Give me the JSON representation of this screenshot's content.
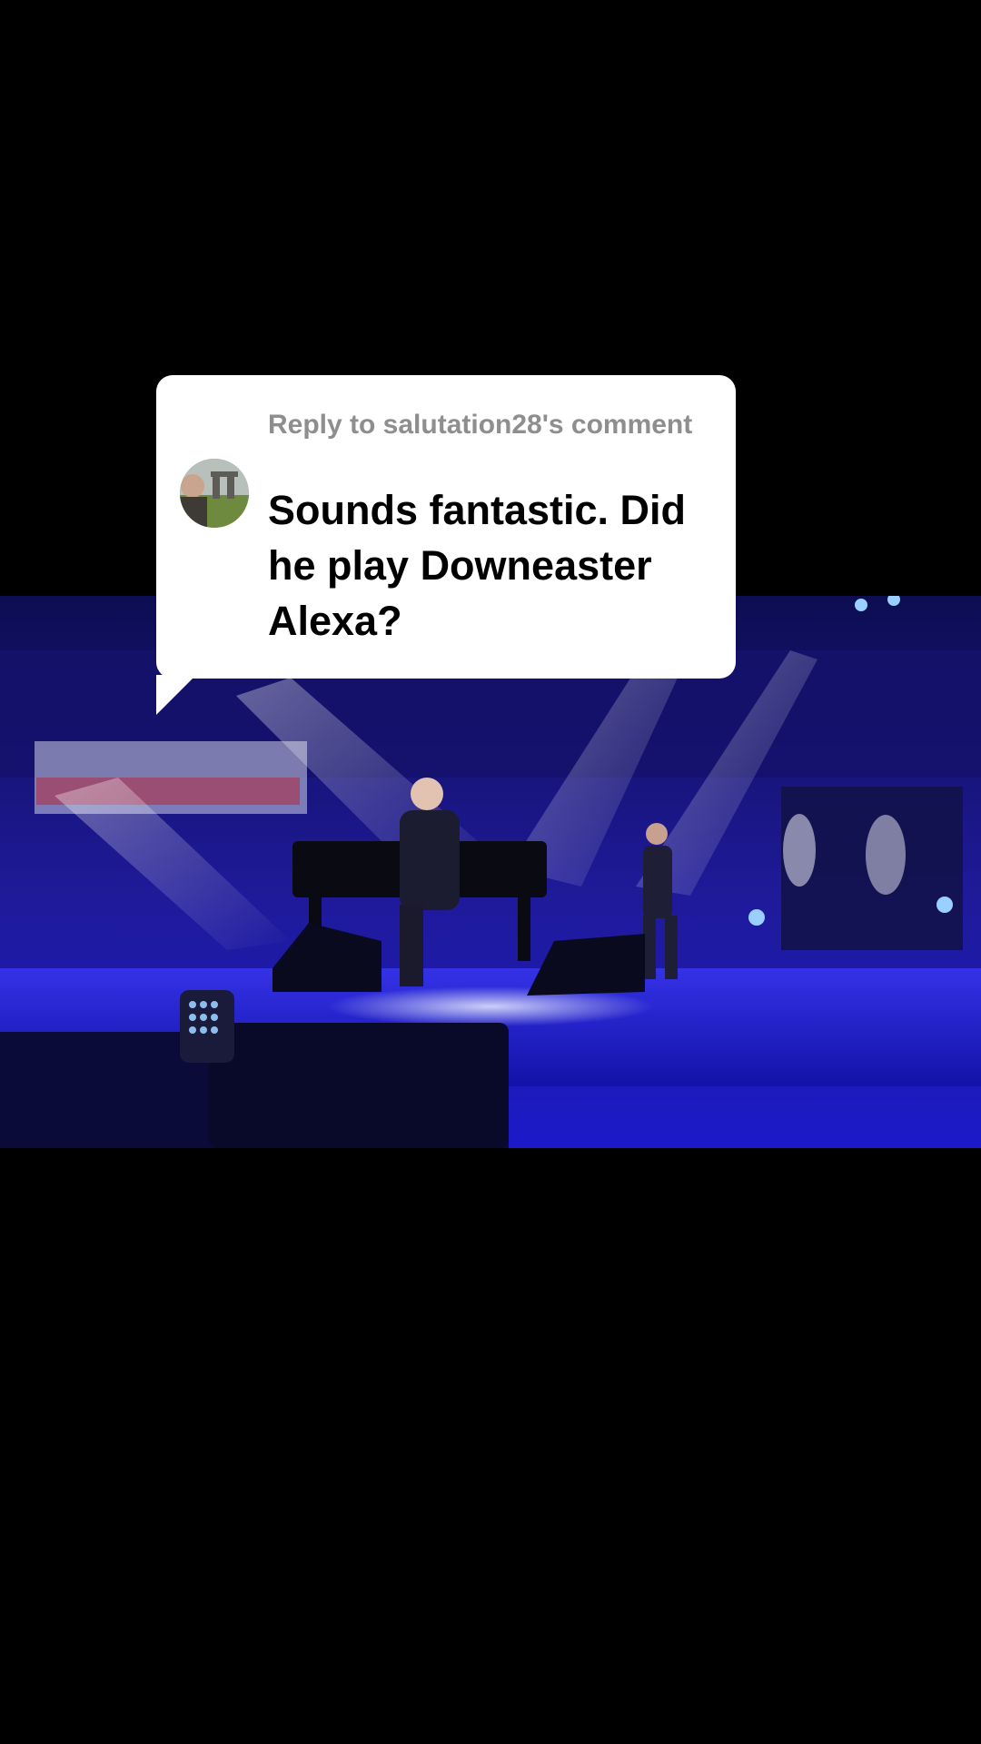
{
  "reply_card": {
    "header": "Reply to salutation28's comment",
    "comment": "Sounds fantastic. Did he play Downeaster Alexa?"
  },
  "avatar": {
    "icon": "user-avatar-photo"
  },
  "video": {
    "scene": "concert-stage-frame"
  },
  "colors": {
    "background": "#000000",
    "card": "#ffffff",
    "header_text": "#8e8e8e",
    "comment_text": "#000000",
    "stage_blue": "#1a1ad0"
  }
}
